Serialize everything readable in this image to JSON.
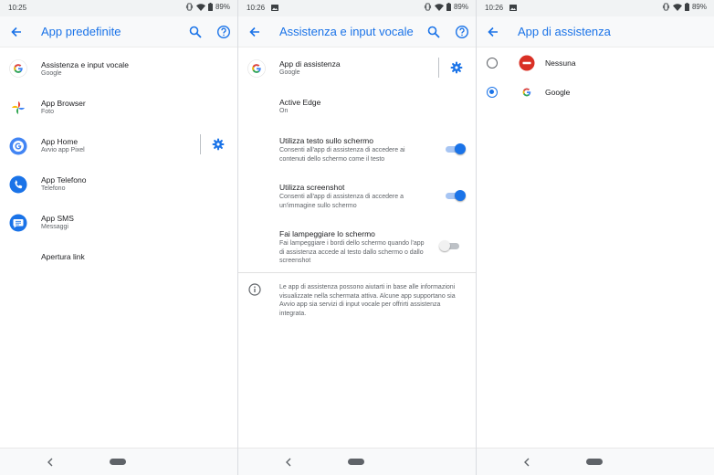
{
  "colors": {
    "accent": "#1a73e8",
    "status_bar_bg": "#f1f3f4",
    "app_bar_bg": "#f8f9fa"
  },
  "panel1": {
    "status": {
      "time": "10:25",
      "battery": "89%"
    },
    "appbar": {
      "title": "App predefinite",
      "actions": [
        "search-icon",
        "help-icon"
      ]
    },
    "items": [
      {
        "title": "Assistenza e input vocale",
        "subtitle": "Google",
        "icon": "google-icon"
      },
      {
        "title": "App Browser",
        "subtitle": "Foto",
        "icon": "photos-icon"
      },
      {
        "title": "App Home",
        "subtitle": "Avvio app Pixel",
        "icon": "pixel-launcher-icon"
      },
      {
        "title": "App Telefono",
        "subtitle": "Telefono",
        "icon": "phone-icon"
      },
      {
        "title": "App SMS",
        "subtitle": "Messaggi",
        "icon": "messages-icon"
      },
      {
        "title": "Apertura link",
        "subtitle": "",
        "icon": ""
      }
    ]
  },
  "panel2": {
    "status": {
      "time": "10:26",
      "battery": "89%"
    },
    "appbar": {
      "title": "Assistenza e input vocale",
      "actions": [
        "search-icon",
        "help-icon"
      ]
    },
    "assist_app": {
      "title": "App di assistenza",
      "subtitle": "Google"
    },
    "active_edge": {
      "title": "Active Edge",
      "subtitle": "On"
    },
    "toggles": [
      {
        "title": "Utilizza testo sullo schermo",
        "desc": "Consenti all'app di assistenza di accedere ai contenuti dello schermo come il testo",
        "on": true
      },
      {
        "title": "Utilizza screenshot",
        "desc": "Consenti all'app di assistenza di accedere a un'immagine sullo schermo",
        "on": true
      },
      {
        "title": "Fai lampeggiare lo schermo",
        "desc": "Fai lampeggiare i bordi dello schermo quando l'app di assistenza accede al testo dallo schermo o dallo screenshot",
        "on": false
      }
    ],
    "info": "Le app di assistenza possono aiutarti in base alle informazioni visualizzate nella schermata attiva. Alcune app supportano sia Avvio app sia servizi di input vocale per offrirti assistenza integrata."
  },
  "panel3": {
    "status": {
      "time": "10:26",
      "battery": "89%"
    },
    "appbar": {
      "title": "App di assistenza"
    },
    "options": [
      {
        "label": "Nessuna",
        "icon": "none-icon",
        "selected": false
      },
      {
        "label": "Google",
        "icon": "google-icon",
        "selected": true
      }
    ]
  }
}
